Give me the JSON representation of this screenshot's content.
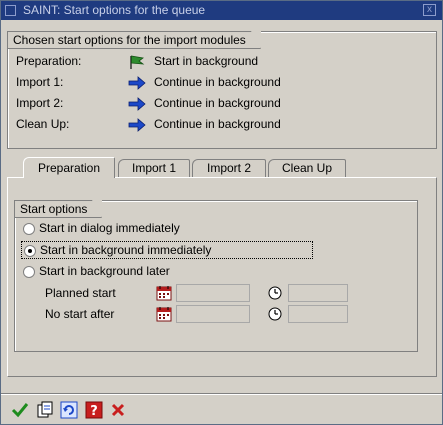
{
  "window": {
    "title": "SAINT: Start options for the queue",
    "close_label": "x"
  },
  "chosen_options": {
    "heading": "Chosen start options for the import modules",
    "rows": [
      {
        "label": "Preparation:",
        "value": "Start in background",
        "icon": "green-flag-icon"
      },
      {
        "label": "Import 1:",
        "value": "Continue in background",
        "icon": "blue-arrow-icon"
      },
      {
        "label": "Import 2:",
        "value": "Continue in background",
        "icon": "blue-arrow-icon"
      },
      {
        "label": "Clean Up:",
        "value": "Continue in background",
        "icon": "blue-arrow-icon"
      }
    ]
  },
  "tabs": [
    {
      "label": "Preparation",
      "active": true
    },
    {
      "label": "Import 1",
      "active": false
    },
    {
      "label": "Import 2",
      "active": false
    },
    {
      "label": "Clean Up",
      "active": false
    }
  ],
  "start_options": {
    "heading": "Start options",
    "radios": [
      {
        "label": "Start in dialog immediately",
        "checked": false
      },
      {
        "label": "Start in background immediately",
        "checked": true
      },
      {
        "label": "Start in background later",
        "checked": false
      }
    ],
    "planned_start": {
      "label": "Planned start",
      "date": "",
      "time": ""
    },
    "no_start_after": {
      "label": "No start after",
      "date": "",
      "time": ""
    }
  },
  "toolbar": {
    "buttons": [
      "confirm-icon",
      "copy-icon",
      "refresh-icon",
      "help-icon",
      "cancel-icon"
    ]
  },
  "colors": {
    "title_bar": "#1f3b80",
    "dialog_bg": "#d4d0c8",
    "arrow_blue": "#1c48c8",
    "flag_green": "#2e8b2e",
    "cancel_red": "#c81e1e"
  }
}
